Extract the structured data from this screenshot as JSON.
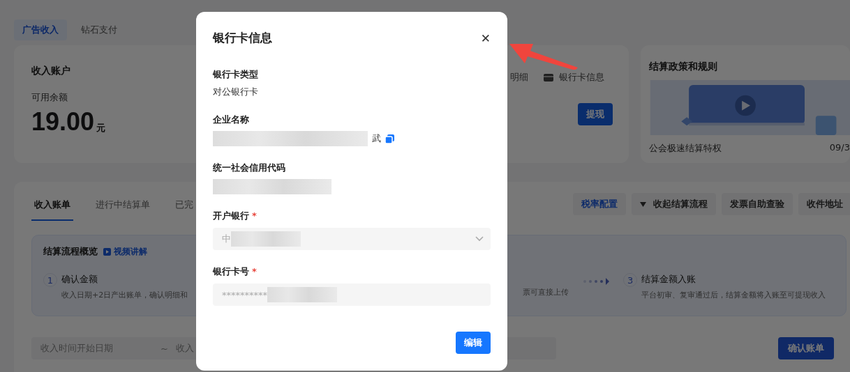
{
  "top_tabs": [
    {
      "label": "广告收入",
      "selected": true
    },
    {
      "label": "钻石支付",
      "selected": false
    }
  ],
  "account_card": {
    "title": "收入账户",
    "balance_label": "可用余额",
    "balance": "19.00",
    "unit": "元",
    "links": [
      {
        "kind": "partial",
        "label": "明细"
      },
      {
        "kind": "card",
        "label": "银行卡信息"
      }
    ],
    "withdraw_button": "提现"
  },
  "policy_card": {
    "title": "结算政策和规则",
    "item": {
      "title": "公会极速结算特权",
      "date": "09/3"
    }
  },
  "bill_section": {
    "tabs": [
      {
        "label": "收入账单",
        "selected": true
      },
      {
        "label": "进行中结算单",
        "selected": false
      },
      {
        "label": "已完",
        "selected": false
      }
    ],
    "actions": [
      {
        "kind": "link",
        "label": "税率配置"
      },
      {
        "kind": "toggle",
        "label": "收起结算流程"
      },
      {
        "kind": "plain",
        "label": "发票自助查验"
      },
      {
        "kind": "plain",
        "label": "收件地址"
      }
    ],
    "process": {
      "title": "结算流程概览",
      "video_link": "视频讲解",
      "steps": [
        {
          "number": "1",
          "title": "确认金额",
          "description": "收入日期+2日产出账单，确认明细和"
        },
        {
          "number": "3",
          "title": "结算金额入账",
          "description": "平台初审、复审通过后，结算金额将入账至可提现收入"
        }
      ],
      "middle_fragment": "票可直接上传"
    },
    "date_field": {
      "start_placeholder": "收入时间开始日期",
      "separator": "~",
      "end_placeholder": "收入"
    },
    "confirm_button": "确认账单"
  },
  "dialog": {
    "title": "银行卡信息",
    "close": "✕",
    "fields": [
      {
        "kind": "text",
        "label": "银行卡类型",
        "value": "对公银行卡"
      },
      {
        "kind": "copyable",
        "label": "企业名称",
        "value": "武",
        "redacted": true
      },
      {
        "kind": "text",
        "label": "统一社会信用代码",
        "redacted": true
      },
      {
        "kind": "select",
        "label": "开户银行",
        "value": "中",
        "required_mark": "*",
        "redacted": true,
        "disabled": true
      },
      {
        "kind": "input",
        "label": "银行卡号",
        "value": "**********",
        "required_mark": "*",
        "redacted": true,
        "disabled": true
      }
    ],
    "edit_button": "编辑"
  }
}
